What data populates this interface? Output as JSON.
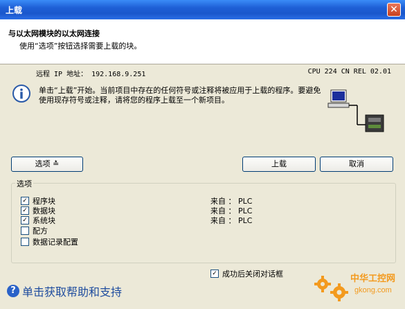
{
  "window": {
    "title": "上载",
    "close_glyph": "✕"
  },
  "header": {
    "title": "与以太网模块的以太网连接",
    "subtitle": "使用“选项”按钮选择需要上载的块。"
  },
  "connection": {
    "remote_ip": "远程 IP 地址： 192.168.9.251",
    "cpu": "CPU 224 CN REL 02.01"
  },
  "message": "单击“上载”开始。当前项目中存在的任何符号或注释将被应用于上载的程序。要避免使用现存符号或注释，请将您的程序上载至一个新项目。",
  "buttons": {
    "options": "选项 ≛",
    "upload": "上载",
    "cancel": "取消"
  },
  "options_group": {
    "label": "选项",
    "items": [
      {
        "label": "程序块",
        "checked": "✓",
        "source": "来自 ： PLC"
      },
      {
        "label": "数据块",
        "checked": "✓",
        "source": "来自 ： PLC"
      },
      {
        "label": "系统块",
        "checked": "✓",
        "source": "来自 ： PLC"
      },
      {
        "label": "配方",
        "checked": "",
        "source": ""
      },
      {
        "label": "数据记录配置",
        "checked": "",
        "source": ""
      }
    ]
  },
  "close_on_success": {
    "label": "成功后关闭对话框",
    "checked": "✓"
  },
  "help": {
    "icon": "?",
    "text": "单击获取帮助和支持"
  },
  "logo": {
    "line1": "中华工控网",
    "line2": "gkong.com"
  },
  "colors": {
    "title_bar": "#1e5fd6",
    "dialog_bg": "#ece9d8",
    "help_text": "#1e4c9e",
    "logo_orange": "#f39a1e"
  }
}
